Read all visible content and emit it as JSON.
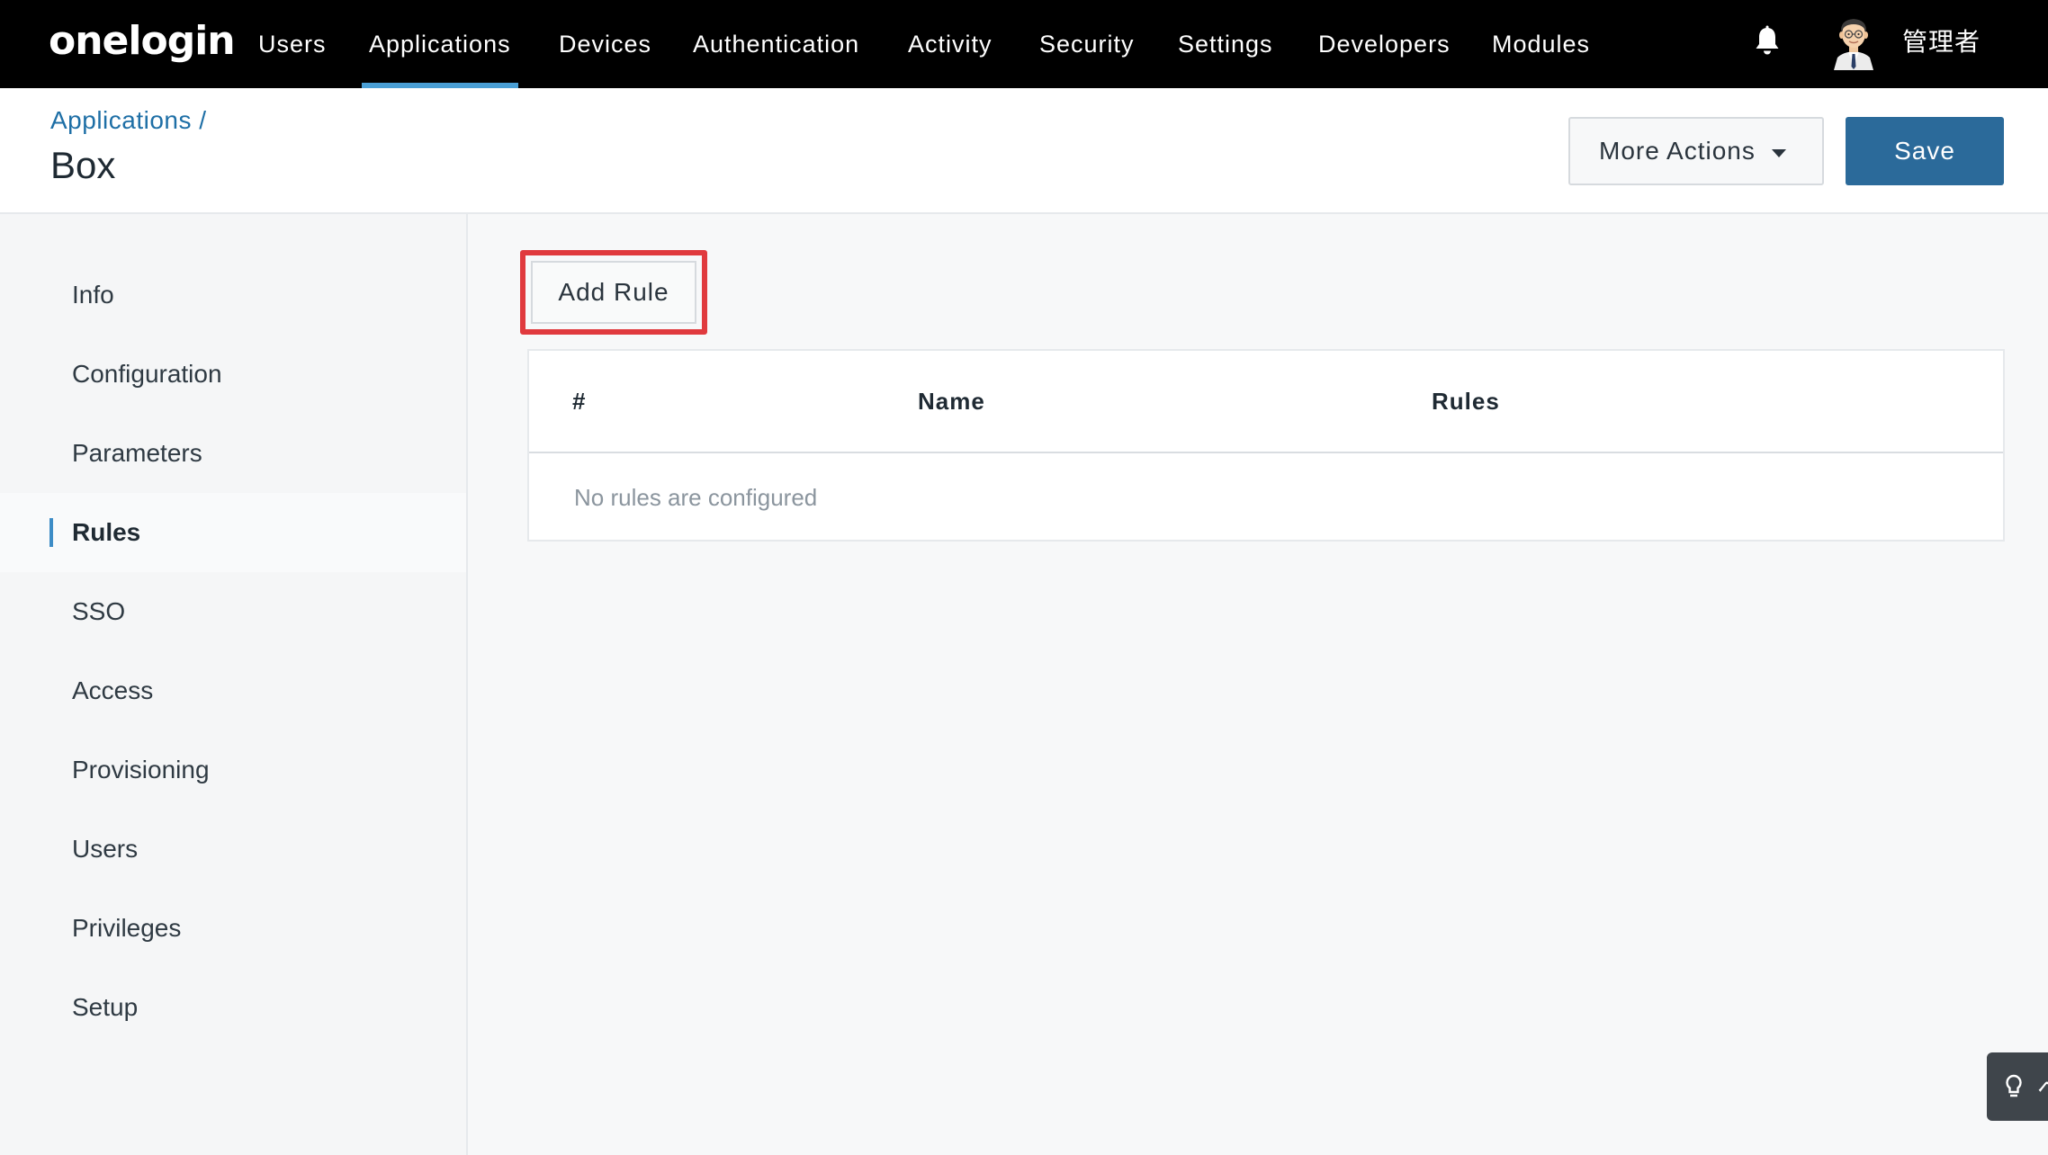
{
  "app": {
    "logo_text": "onelogin",
    "user_name": "管理者"
  },
  "nav": {
    "items": [
      {
        "label": "Users"
      },
      {
        "label": "Applications",
        "active": true
      },
      {
        "label": "Devices"
      },
      {
        "label": "Authentication"
      },
      {
        "label": "Activity"
      },
      {
        "label": "Security"
      },
      {
        "label": "Settings"
      },
      {
        "label": "Developers"
      },
      {
        "label": "Modules"
      }
    ]
  },
  "header": {
    "breadcrumb": "Applications /",
    "title": "Box",
    "more_actions_label": "More Actions",
    "save_label": "Save"
  },
  "sidebar": {
    "items": [
      {
        "label": "Info"
      },
      {
        "label": "Configuration"
      },
      {
        "label": "Parameters"
      },
      {
        "label": "Rules",
        "active": true
      },
      {
        "label": "SSO"
      },
      {
        "label": "Access"
      },
      {
        "label": "Provisioning"
      },
      {
        "label": "Users"
      },
      {
        "label": "Privileges"
      },
      {
        "label": "Setup"
      }
    ]
  },
  "main": {
    "add_rule_label": "Add Rule",
    "table": {
      "columns": [
        "#",
        "Name",
        "Rules"
      ],
      "empty_message": "No rules are configured"
    }
  },
  "help_tab": {
    "label": "ヘ"
  },
  "colors": {
    "nav_bg": "#000000",
    "nav_active_underline": "#4a9fd5",
    "link": "#1e6fa6",
    "primary_button": "#2b6a9a",
    "highlight_box": "#e03a3e",
    "active_indicator": "#3d8cc6"
  }
}
